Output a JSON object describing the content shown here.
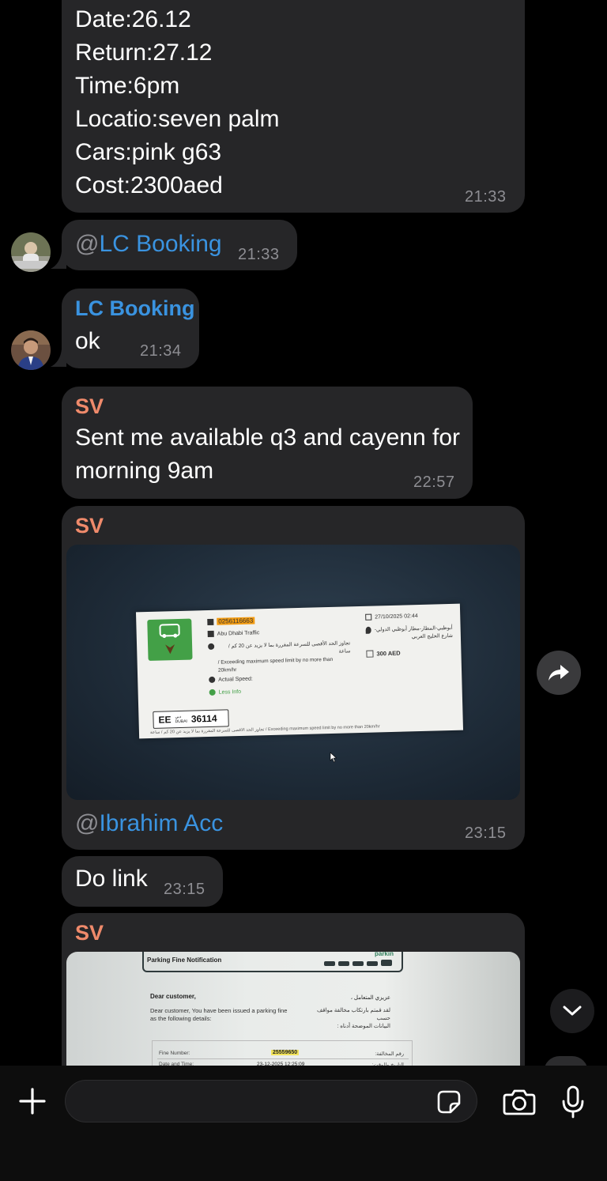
{
  "messages": {
    "m1": {
      "lines": "Date:26.12\nReturn:27.12\nTime:6pm\nLocatio:seven palm\nCars:pink g63\nCost:2300aed",
      "time": "21:33"
    },
    "m2": {
      "at": "@",
      "mention": "LC Booking",
      "time": "21:33"
    },
    "m3": {
      "sender": "LC Booking",
      "text": "ok",
      "time": "21:34",
      "sender_color": "#3a93e0"
    },
    "m4": {
      "sender": "SV",
      "text": "Sent me available q3 and cayenn for\nmorning 9am",
      "time": "22:57",
      "sender_color": "#ef8a6b"
    },
    "m5": {
      "sender": "SV",
      "at": "@",
      "mention": "Ibrahim Acc",
      "time": "23:15",
      "photo": {
        "ticket": "0256116663",
        "authority": "Abu Dhabi Traffic",
        "violation_ar": "تجاوز الحد الأقصى للسرعة المقررة بما لا يزيد عن 20 كم / ساعة",
        "violation_en": "/ Exceeding maximum speed limit by no more than 20km/hr",
        "actual_speed": "Actual Speed:",
        "less_info": "Less Info",
        "date": "27/10/2025  02:44",
        "location": "أبوظبي-المطار-مطار أبوظبي الدولي- شارع الخليج العربي",
        "amount": "300 AED",
        "plate_code": "EE",
        "plate_city_ar": "دبي",
        "plate_city": "DUBAI",
        "plate_number": "36114",
        "footer": "تجاوز الحد الأقصى للسرعة المقررة بما لا يزيد عن 20 كم / ساعة / Exceeding maximum speed limit by no more than 20km/hr"
      }
    },
    "m6": {
      "text": "Do link",
      "time": "23:15"
    },
    "m7": {
      "sender": "SV",
      "photo": {
        "title": "Parking Fine Notification",
        "brand": "parkin",
        "greeting": "Dear customer,",
        "greeting_ar": "عزيزي المتعامل ،",
        "body": "Dear customer, You have been issued a parking fine\nas the following details:",
        "body_ar": "لقد قمتم بارتكاب مخالفة مواقف حسب\nالبيانات الموضحة أدناه :",
        "fine_label": "Fine Number:",
        "fine_value": "25559650",
        "fine_label_ar": "رقم المخالفة:",
        "date_label": "Date and Time:",
        "date_value": "23-12-2025 12:25:09",
        "date_label_ar": "التاريخ والوقت:"
      }
    }
  },
  "icons": {
    "forward": "forward-arrow-icon",
    "scroll_down": "chevron-down-icon",
    "attach": "plus-icon",
    "sticker": "sticker-icon",
    "camera": "camera-icon",
    "mic": "microphone-icon"
  },
  "colors": {
    "bubble": "#262628",
    "mention": "#3a93e0",
    "sv_name": "#ef8a6b",
    "time": "#8e8e93"
  }
}
